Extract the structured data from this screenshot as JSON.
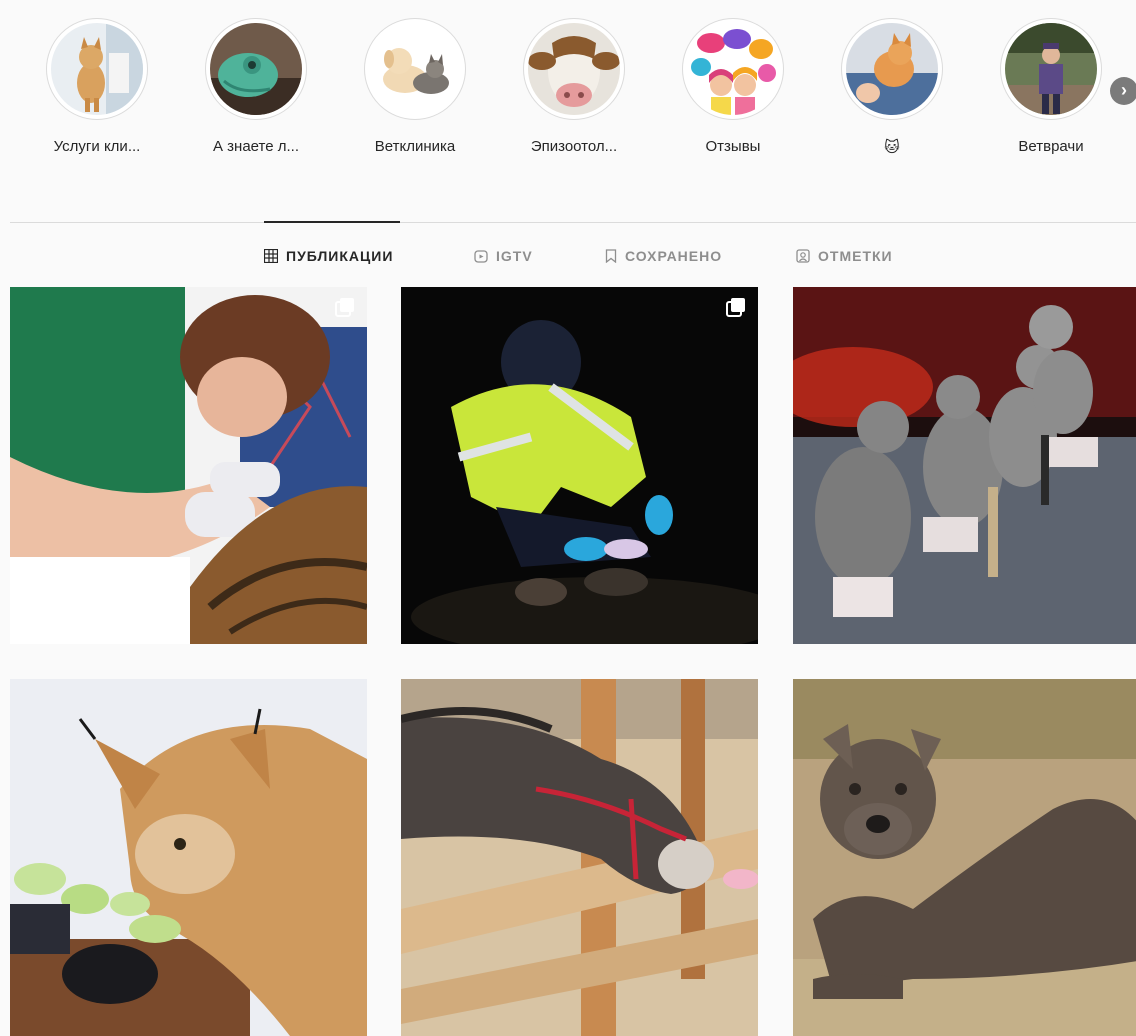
{
  "stories": [
    {
      "label": "Услуги кли...",
      "thumb": "dog-vet"
    },
    {
      "label": "А знаете л...",
      "thumb": "chameleon"
    },
    {
      "label": "Ветклиника",
      "thumb": "puppy-kitten"
    },
    {
      "label": "Эпизоотол...",
      "thumb": "cow"
    },
    {
      "label": "Отзывы",
      "thumb": "speech-bubbles"
    },
    {
      "label": "🐱",
      "thumb": "cat-held"
    },
    {
      "label": "Ветврачи",
      "thumb": "person-outdoors"
    }
  ],
  "tabs": [
    {
      "label": "ПУБЛИКАЦИИ",
      "icon": "grid-icon",
      "active": true
    },
    {
      "label": "IGTV",
      "icon": "igtv-icon",
      "active": false
    },
    {
      "label": "СОХРАНЕНО",
      "icon": "bookmark-icon",
      "active": false
    },
    {
      "label": "ОТМЕТКИ",
      "icon": "tag-person-icon",
      "active": false
    }
  ],
  "posts": [
    {
      "subject": "vet-with-cat",
      "multiple": true
    },
    {
      "subject": "night-worker-with-animal",
      "multiple": true
    },
    {
      "subject": "circus-elephants",
      "multiple": false
    },
    {
      "subject": "lynx-eating-apple",
      "multiple": false
    },
    {
      "subject": "donkey-at-fence",
      "multiple": false
    },
    {
      "subject": "pitbull-lying",
      "multiple": false
    }
  ],
  "colors": {
    "background": "#fafafa",
    "divider": "#dbdbdb",
    "active_text": "#262626",
    "inactive_text": "#8e8e8e"
  }
}
